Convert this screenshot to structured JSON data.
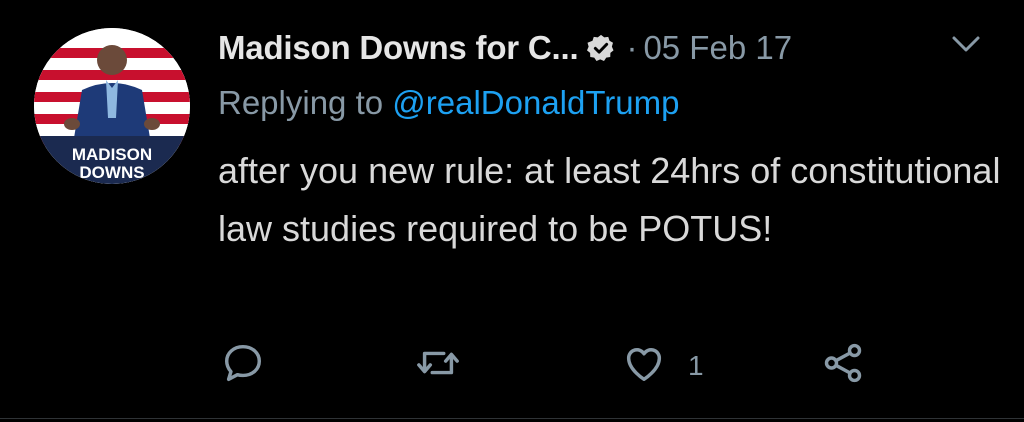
{
  "tweet": {
    "author_name": "Madison Downs for C...",
    "separator": "·",
    "date": "05 Feb 17",
    "replying_prefix": "Replying to ",
    "replying_to": "@realDonaldTrump",
    "text": "after you new rule: at least 24hrs of constitutional law studies required to be POTUS!",
    "avatar_text_line1": "MADISON",
    "avatar_text_line2": "DOWNS",
    "verified": true
  },
  "actions": {
    "reply_icon": "reply-icon",
    "retweet_icon": "retweet-icon",
    "like_icon": "heart-icon",
    "like_count": "1",
    "share_icon": "share-icon"
  },
  "colors": {
    "background": "#000000",
    "text": "#d9d9d9",
    "muted": "#8899a6",
    "link": "#1da1f2"
  }
}
